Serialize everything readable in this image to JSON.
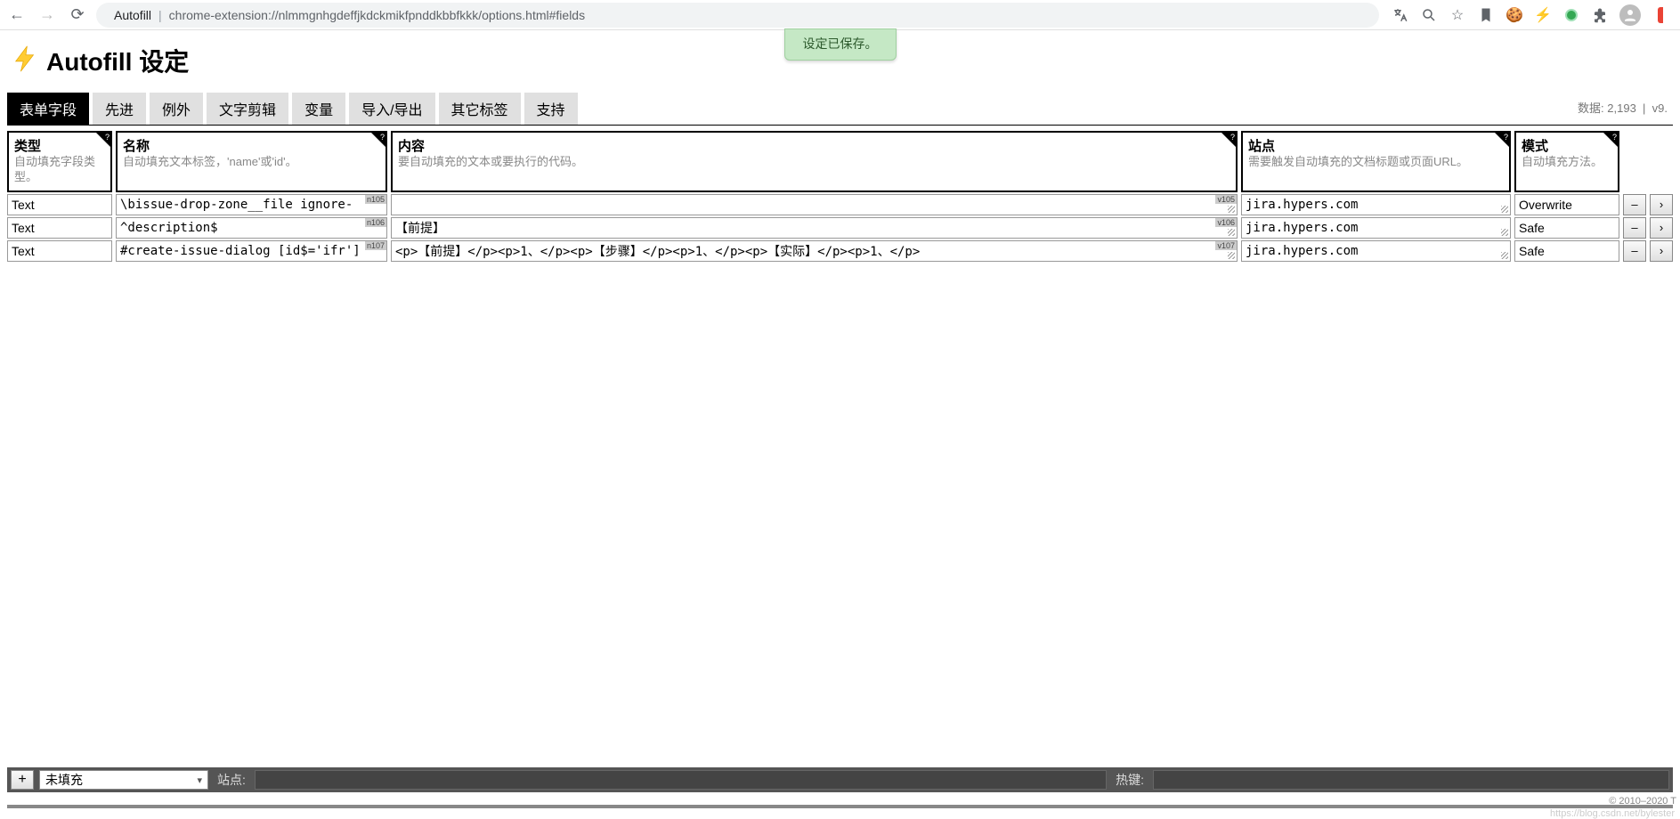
{
  "chrome": {
    "ext_name": "Autofill",
    "url": "chrome-extension://nlmmgnhgdeffjkdckmikfpnddkbbfkkk/options.html#fields"
  },
  "header": {
    "title": "Autofill 设定",
    "saved_toast": "设定已保存。"
  },
  "tabs": [
    {
      "label": "表单字段",
      "active": true
    },
    {
      "label": "先进",
      "active": false
    },
    {
      "label": "例外",
      "active": false
    },
    {
      "label": "文字剪辑",
      "active": false
    },
    {
      "label": "变量",
      "active": false
    },
    {
      "label": "导入/导出",
      "active": false
    },
    {
      "label": "其它标签",
      "active": false
    },
    {
      "label": "支持",
      "active": false
    }
  ],
  "meta": {
    "data_label": "数据:",
    "data_count": "2,193",
    "version": "v9."
  },
  "columns": {
    "type": {
      "title": "类型",
      "desc": "自动填充字段类型。"
    },
    "name": {
      "title": "名称",
      "desc": "自动填充文本标签，'name'或'id'。"
    },
    "value": {
      "title": "内容",
      "desc": "要自动填充的文本或要执行的代码。"
    },
    "site": {
      "title": "站点",
      "desc": "需要触发自动填充的文档标题或页面URL。"
    },
    "mode": {
      "title": "模式",
      "desc": "自动填充方法。"
    }
  },
  "rows": [
    {
      "type": "Text",
      "name": "\\bissue-drop-zone__file ignore-",
      "name_badge": "n105",
      "value": "",
      "value_badge": "v105",
      "site": "jira.hypers.com",
      "mode": "Overwrite"
    },
    {
      "type": "Text",
      "name": "^description$",
      "name_badge": "n106",
      "value": "【前提】",
      "value_badge": "v106",
      "site": "jira.hypers.com",
      "mode": "Safe"
    },
    {
      "type": "Text",
      "name": "#create-issue-dialog [id$='ifr']",
      "name_badge": "n107",
      "value": "<p>【前提】</p><p>1、</p><p>【步骤】</p><p>1、</p><p>【实际】</p><p>1、</p>",
      "value_badge": "v107",
      "site": "jira.hypers.com",
      "mode": "Safe"
    }
  ],
  "footer": {
    "plus": "+",
    "select": "未填充",
    "site_label": "站点:",
    "hotkey_label": "热键:"
  },
  "row_buttons": {
    "minus": "–",
    "move": "›"
  },
  "copyright": "© 2010–2020 T",
  "watermark": "https://blog.csdn.net/bylester"
}
